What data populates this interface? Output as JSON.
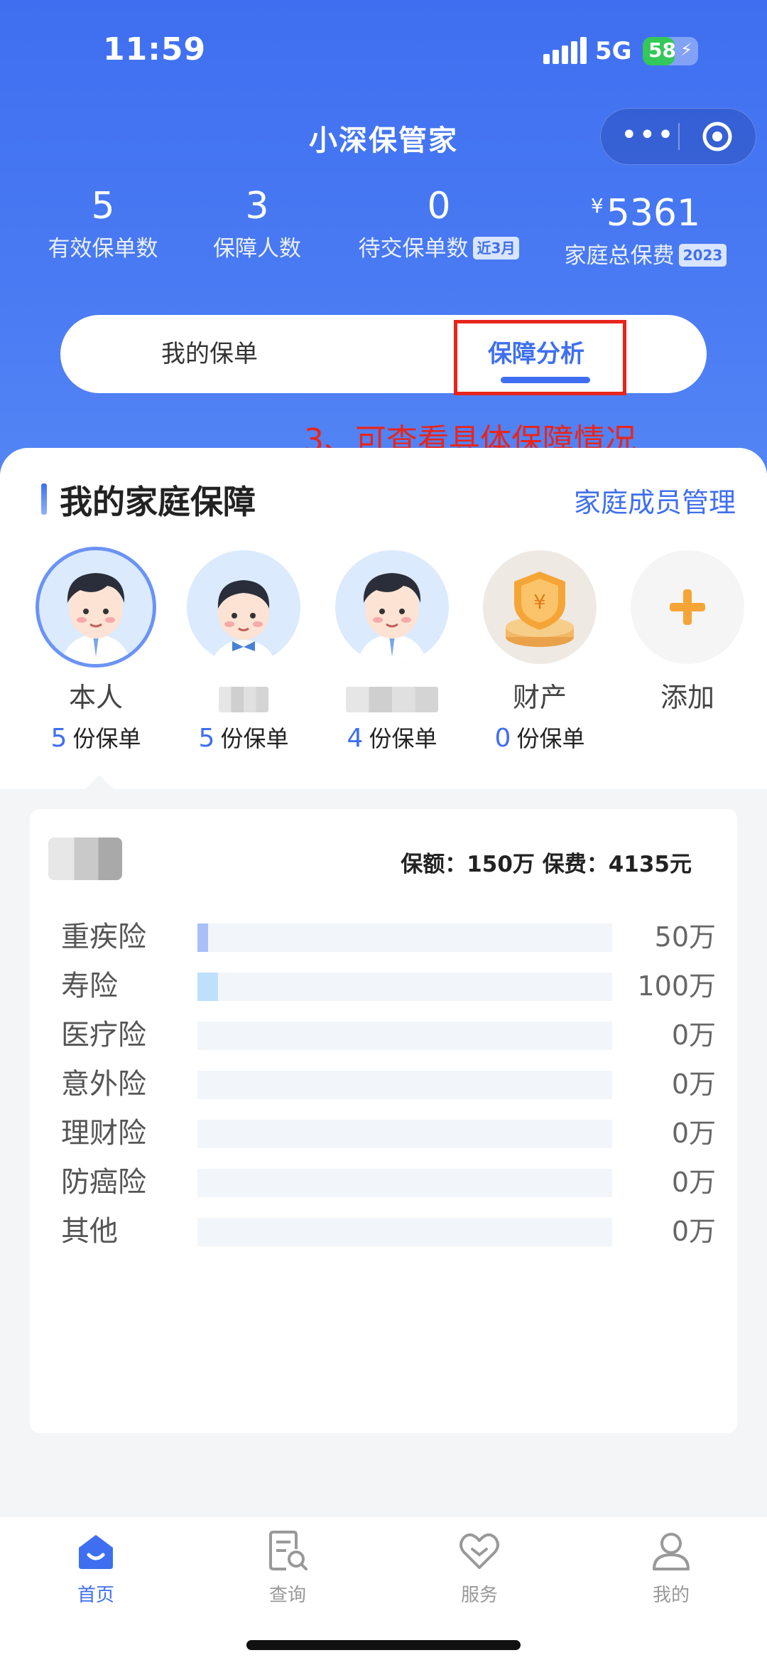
{
  "status_bar": {
    "time": "11:59",
    "network": "5G",
    "battery": "58",
    "battery_level": 0.58
  },
  "header": {
    "title": "小深保管家"
  },
  "stats": [
    {
      "value": "5",
      "label": "有效保单数"
    },
    {
      "value": "3",
      "label": "保障人数"
    },
    {
      "value": "0",
      "label": "待交保单数",
      "tag": "近3月"
    },
    {
      "currency": "¥",
      "value": "5361",
      "label": "家庭总保费",
      "tag": "2023"
    }
  ],
  "tabs": {
    "my_policies": "我的保单",
    "analysis": "保障分析",
    "active": "保障分析"
  },
  "annotation": "3、可查看具体保障情况",
  "family": {
    "title": "我的家庭保障",
    "manage_link": "家庭成员管理",
    "members": [
      {
        "name": "本人",
        "count": "5",
        "unit": "份保单",
        "avatar": "man-avatar-icon"
      },
      {
        "name": "",
        "count": "5",
        "unit": "份保单",
        "avatar": "child-avatar-icon"
      },
      {
        "name": "",
        "count": "4",
        "unit": "份保单",
        "avatar": "man-avatar-icon"
      },
      {
        "name": "财产",
        "count": "0",
        "unit": "份保单",
        "avatar": "shield-icon"
      },
      {
        "name": "添加",
        "avatar": "plus-icon"
      }
    ]
  },
  "coverage": {
    "summary": "保额：150万  保费：4135元",
    "rows": [
      {
        "label": "重疾险",
        "value": "50万",
        "amount": 50,
        "color": "#a9bffa"
      },
      {
        "label": "寿险",
        "value": "100万",
        "amount": 100,
        "color": "#bfe0fd"
      },
      {
        "label": "医疗险",
        "value": "0万",
        "amount": 0,
        "color": "#a9bffa"
      },
      {
        "label": "意外险",
        "value": "0万",
        "amount": 0,
        "color": "#a9bffa"
      },
      {
        "label": "理财险",
        "value": "0万",
        "amount": 0,
        "color": "#a9bffa"
      },
      {
        "label": "防癌险",
        "value": "0万",
        "amount": 0,
        "color": "#a9bffa"
      },
      {
        "label": "其他",
        "value": "0万",
        "amount": 0,
        "color": "#a9bffa"
      }
    ]
  },
  "tabbar": [
    {
      "label": "首页",
      "icon": "home-icon",
      "active": true
    },
    {
      "label": "查询",
      "icon": "query-icon",
      "active": false
    },
    {
      "label": "服务",
      "icon": "heart-icon",
      "active": false
    },
    {
      "label": "我的",
      "icon": "user-icon",
      "active": false
    }
  ],
  "colors": {
    "brand": "#3f6ff0",
    "annotation": "#e8251c"
  }
}
